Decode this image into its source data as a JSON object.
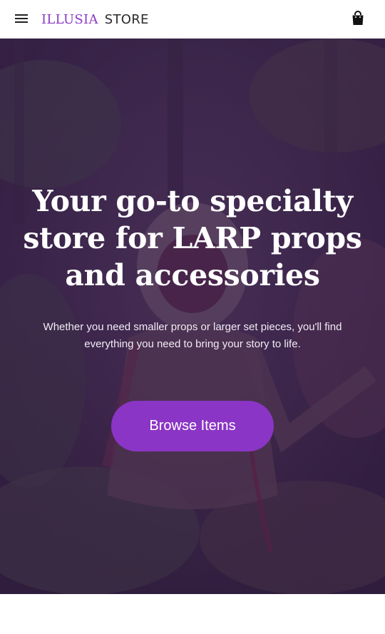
{
  "header": {
    "menu_icon": "hamburger-menu-icon",
    "brand_primary": "ILLUSIA",
    "brand_secondary": "STORE",
    "cart_icon": "shopping-bag-icon"
  },
  "hero": {
    "title": "Your go-to specialty store for LARP props and accessories",
    "subtitle": "Whether you need smaller props or larger set pieces, you'll find everything you need to bring your story to life.",
    "cta_label": "Browse Items"
  },
  "colors": {
    "brand_purple": "#8a3bc4",
    "button_purple": "#8b35c6",
    "overlay_tint": "#3c1e55"
  }
}
